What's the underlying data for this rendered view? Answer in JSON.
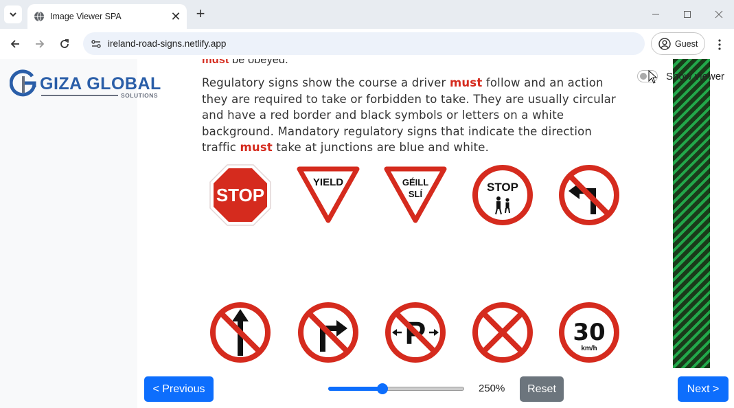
{
  "browser": {
    "tab_title": "Image Viewer SPA",
    "url": "ireland-road-signs.netlify.app",
    "profile_label": "Guest"
  },
  "logo": {
    "brand": "GIZA GLOBAL",
    "subtitle": "SOLUTIONS",
    "colors": {
      "blue": "#2a5ea8",
      "grey": "#6b7280"
    }
  },
  "content": {
    "prev_fragment_word": "must",
    "prev_fragment_rest": " be obeyed.",
    "paragraph": [
      {
        "text": "Regulatory signs show the course a driver ",
        "emph": false
      },
      {
        "text": "must",
        "emph": true
      },
      {
        "text": " follow and an action they are required to take or forbidden to take. They are usually circular and have a red border and black symbols or letters on a white background. Mandatory regulatory signs that indicate the direction traffic ",
        "emph": false
      },
      {
        "text": "must",
        "emph": true
      },
      {
        "text": " take at junctions are blue and white.",
        "emph": false
      }
    ],
    "signs": [
      {
        "id": "stop",
        "text": "STOP"
      },
      {
        "id": "yield",
        "text": "YIELD"
      },
      {
        "id": "geill-sli",
        "line1": "GÉILL",
        "line2": "SLÍ"
      },
      {
        "id": "school-stop",
        "text": "STOP"
      },
      {
        "id": "no-left-turn"
      },
      {
        "id": "no-straight-ahead"
      },
      {
        "id": "no-right-turn"
      },
      {
        "id": "no-parking",
        "text": "P"
      },
      {
        "id": "clearway"
      },
      {
        "id": "speed-limit-30",
        "text": "30",
        "unit": "km/h"
      }
    ],
    "accent_red": "#d52b1e"
  },
  "viewer": {
    "show_viewer_label": "Show viewer",
    "show_viewer_on": false
  },
  "controls": {
    "previous_label": "< Previous",
    "next_label": "Next >",
    "reset_label": "Reset",
    "zoom_text": "250%",
    "zoom_fraction": 0.39
  }
}
